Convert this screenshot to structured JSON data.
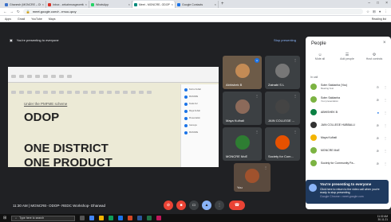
{
  "browser": {
    "tabs": [
      {
        "label": "Ghanesh (MGNCRE – ODOP- Na",
        "color": "#3b71ca"
      },
      {
        "label": "Inbox - zekahmusgeorett@gmail",
        "color": "#d93025"
      },
      {
        "label": "WhatsApp",
        "color": "#25d366"
      },
      {
        "label": "Meet - MGNCRE- ODOP- R",
        "color": "#00897b",
        "active": true
      },
      {
        "label": "Google Contacts",
        "color": "#1a73e8"
      }
    ],
    "new_tab": "+",
    "url": "meet.google.com/r...rmuo-qzcy",
    "bookmarks": [
      "Apps",
      "Gmail",
      "YouTube",
      "Maps"
    ],
    "reading_list": "Reading list"
  },
  "presenting": {
    "text": "You're presenting to everyone",
    "stop_label": "Stop presenting"
  },
  "slide": {
    "subtitle": "Under the PMFME scheme",
    "title": "ODOP",
    "line1": "ONE DISTRICT",
    "line2": "ONE PRODUCT",
    "thumb_labels": [
      "Kulmu Kuhali",
      "MGNCRE",
      "Kuala hul",
      "Maya Kuhali",
      "Presentation",
      "Gansuyu",
      "MGNCRE"
    ]
  },
  "tiles": [
    {
      "name": "Abhishek B",
      "color": "#c48b55"
    },
    {
      "name": "Zainabi S L",
      "color": "#777"
    },
    {
      "name": "Maya Kulhali",
      "color": "#8c6a5a"
    },
    {
      "name": "JAIN COLLEGE ...",
      "color": "#444"
    },
    {
      "name": "MGNCRE MoE",
      "color": "#2e7d32"
    },
    {
      "name": "Society for Com...",
      "color": "#e65100"
    },
    {
      "name": "You",
      "color": "#a0522d"
    }
  ],
  "panel": {
    "title": "People",
    "buttons": [
      {
        "icon": "☺",
        "label": "Mute all"
      },
      {
        "icon": "☰",
        "label": "Add people"
      },
      {
        "icon": "⚙",
        "label": "Host controls"
      }
    ],
    "in_call_label": "In call",
    "people": [
      {
        "name": "Sotrn Saldanha (You)",
        "sub": "Meeting host",
        "color": "#7cb342"
      },
      {
        "name": "Sotrn Saldanha",
        "sub": "Your presentation",
        "color": "#7cb342"
      },
      {
        "name": "ABHISHEK B",
        "sub": "",
        "color": "#0b8043"
      },
      {
        "name": "JAIN COLLEGE HUBBALLI",
        "sub": "",
        "color": "#333333"
      },
      {
        "name": "Maya Kulhali",
        "sub": "",
        "color": "#f4b400"
      },
      {
        "name": "MGNCRE MoE",
        "sub": "",
        "color": "#7cb342"
      },
      {
        "name": "Society for Community Pa...",
        "sub": "",
        "color": "#7cb342"
      }
    ]
  },
  "notification": {
    "title": "You're presenting to everyone",
    "body": "Click here to return to the video call when you're ready to stop presenting",
    "source": "Google Chrome • meet.google.com"
  },
  "meeting": {
    "info": "11:30 AM | MGNCRE- ODOP- REDC Workshop- Dharwad"
  },
  "taskbar": {
    "search": "Type here to search",
    "time": "11:32 AM",
    "date": "30-11-21"
  }
}
